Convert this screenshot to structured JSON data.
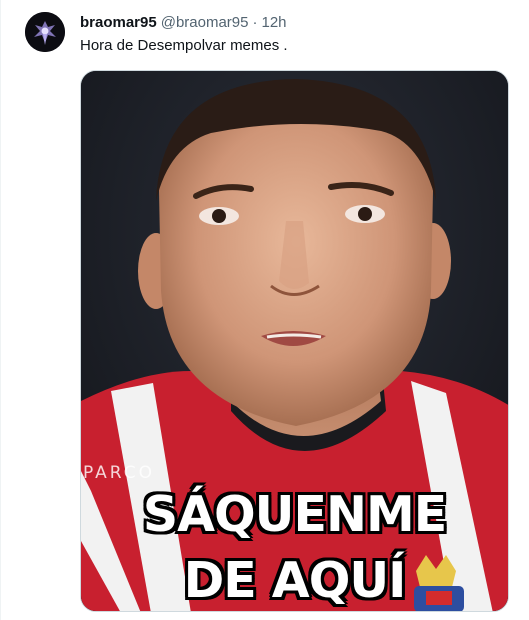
{
  "tweet": {
    "author": {
      "display_name": "braomar95",
      "handle": "@braomar95",
      "avatar_icon": "avatar-purple-figure"
    },
    "separator": "·",
    "time": "12h",
    "text": "Hora de Desempolvar memes .",
    "media": {
      "caption_line1": "SÁQUENME",
      "caption_line2": "DE AQUÍ",
      "watermark": "PARCO"
    }
  },
  "colors": {
    "text_primary": "#0f1419",
    "text_secondary": "#536471",
    "media_border": "#cfd9de",
    "jersey_red": "#c8202f"
  }
}
